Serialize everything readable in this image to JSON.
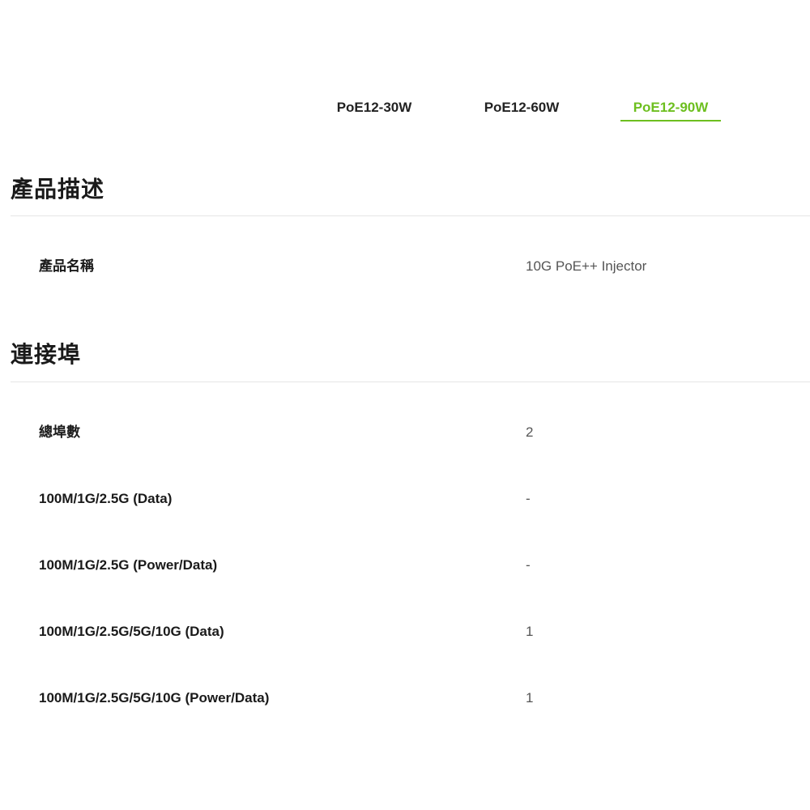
{
  "tabs": [
    {
      "label": "PoE12-30W",
      "active": false
    },
    {
      "label": "PoE12-60W",
      "active": false
    },
    {
      "label": "PoE12-90W",
      "active": true
    }
  ],
  "accent_color": "#6dbf1f",
  "sections": {
    "description": {
      "title": "產品描述",
      "rows": [
        {
          "label": "產品名稱",
          "value": "10G PoE++ Injector"
        }
      ]
    },
    "ports": {
      "title": "連接埠",
      "rows": [
        {
          "label": "總埠數",
          "value": "2"
        },
        {
          "label": "100M/1G/2.5G (Data)",
          "value": "-"
        },
        {
          "label": "100M/1G/2.5G (Power/Data)",
          "value": "-"
        },
        {
          "label": "100M/1G/2.5G/5G/10G (Data)",
          "value": "1"
        },
        {
          "label": "100M/1G/2.5G/5G/10G (Power/Data)",
          "value": "1"
        }
      ]
    }
  }
}
